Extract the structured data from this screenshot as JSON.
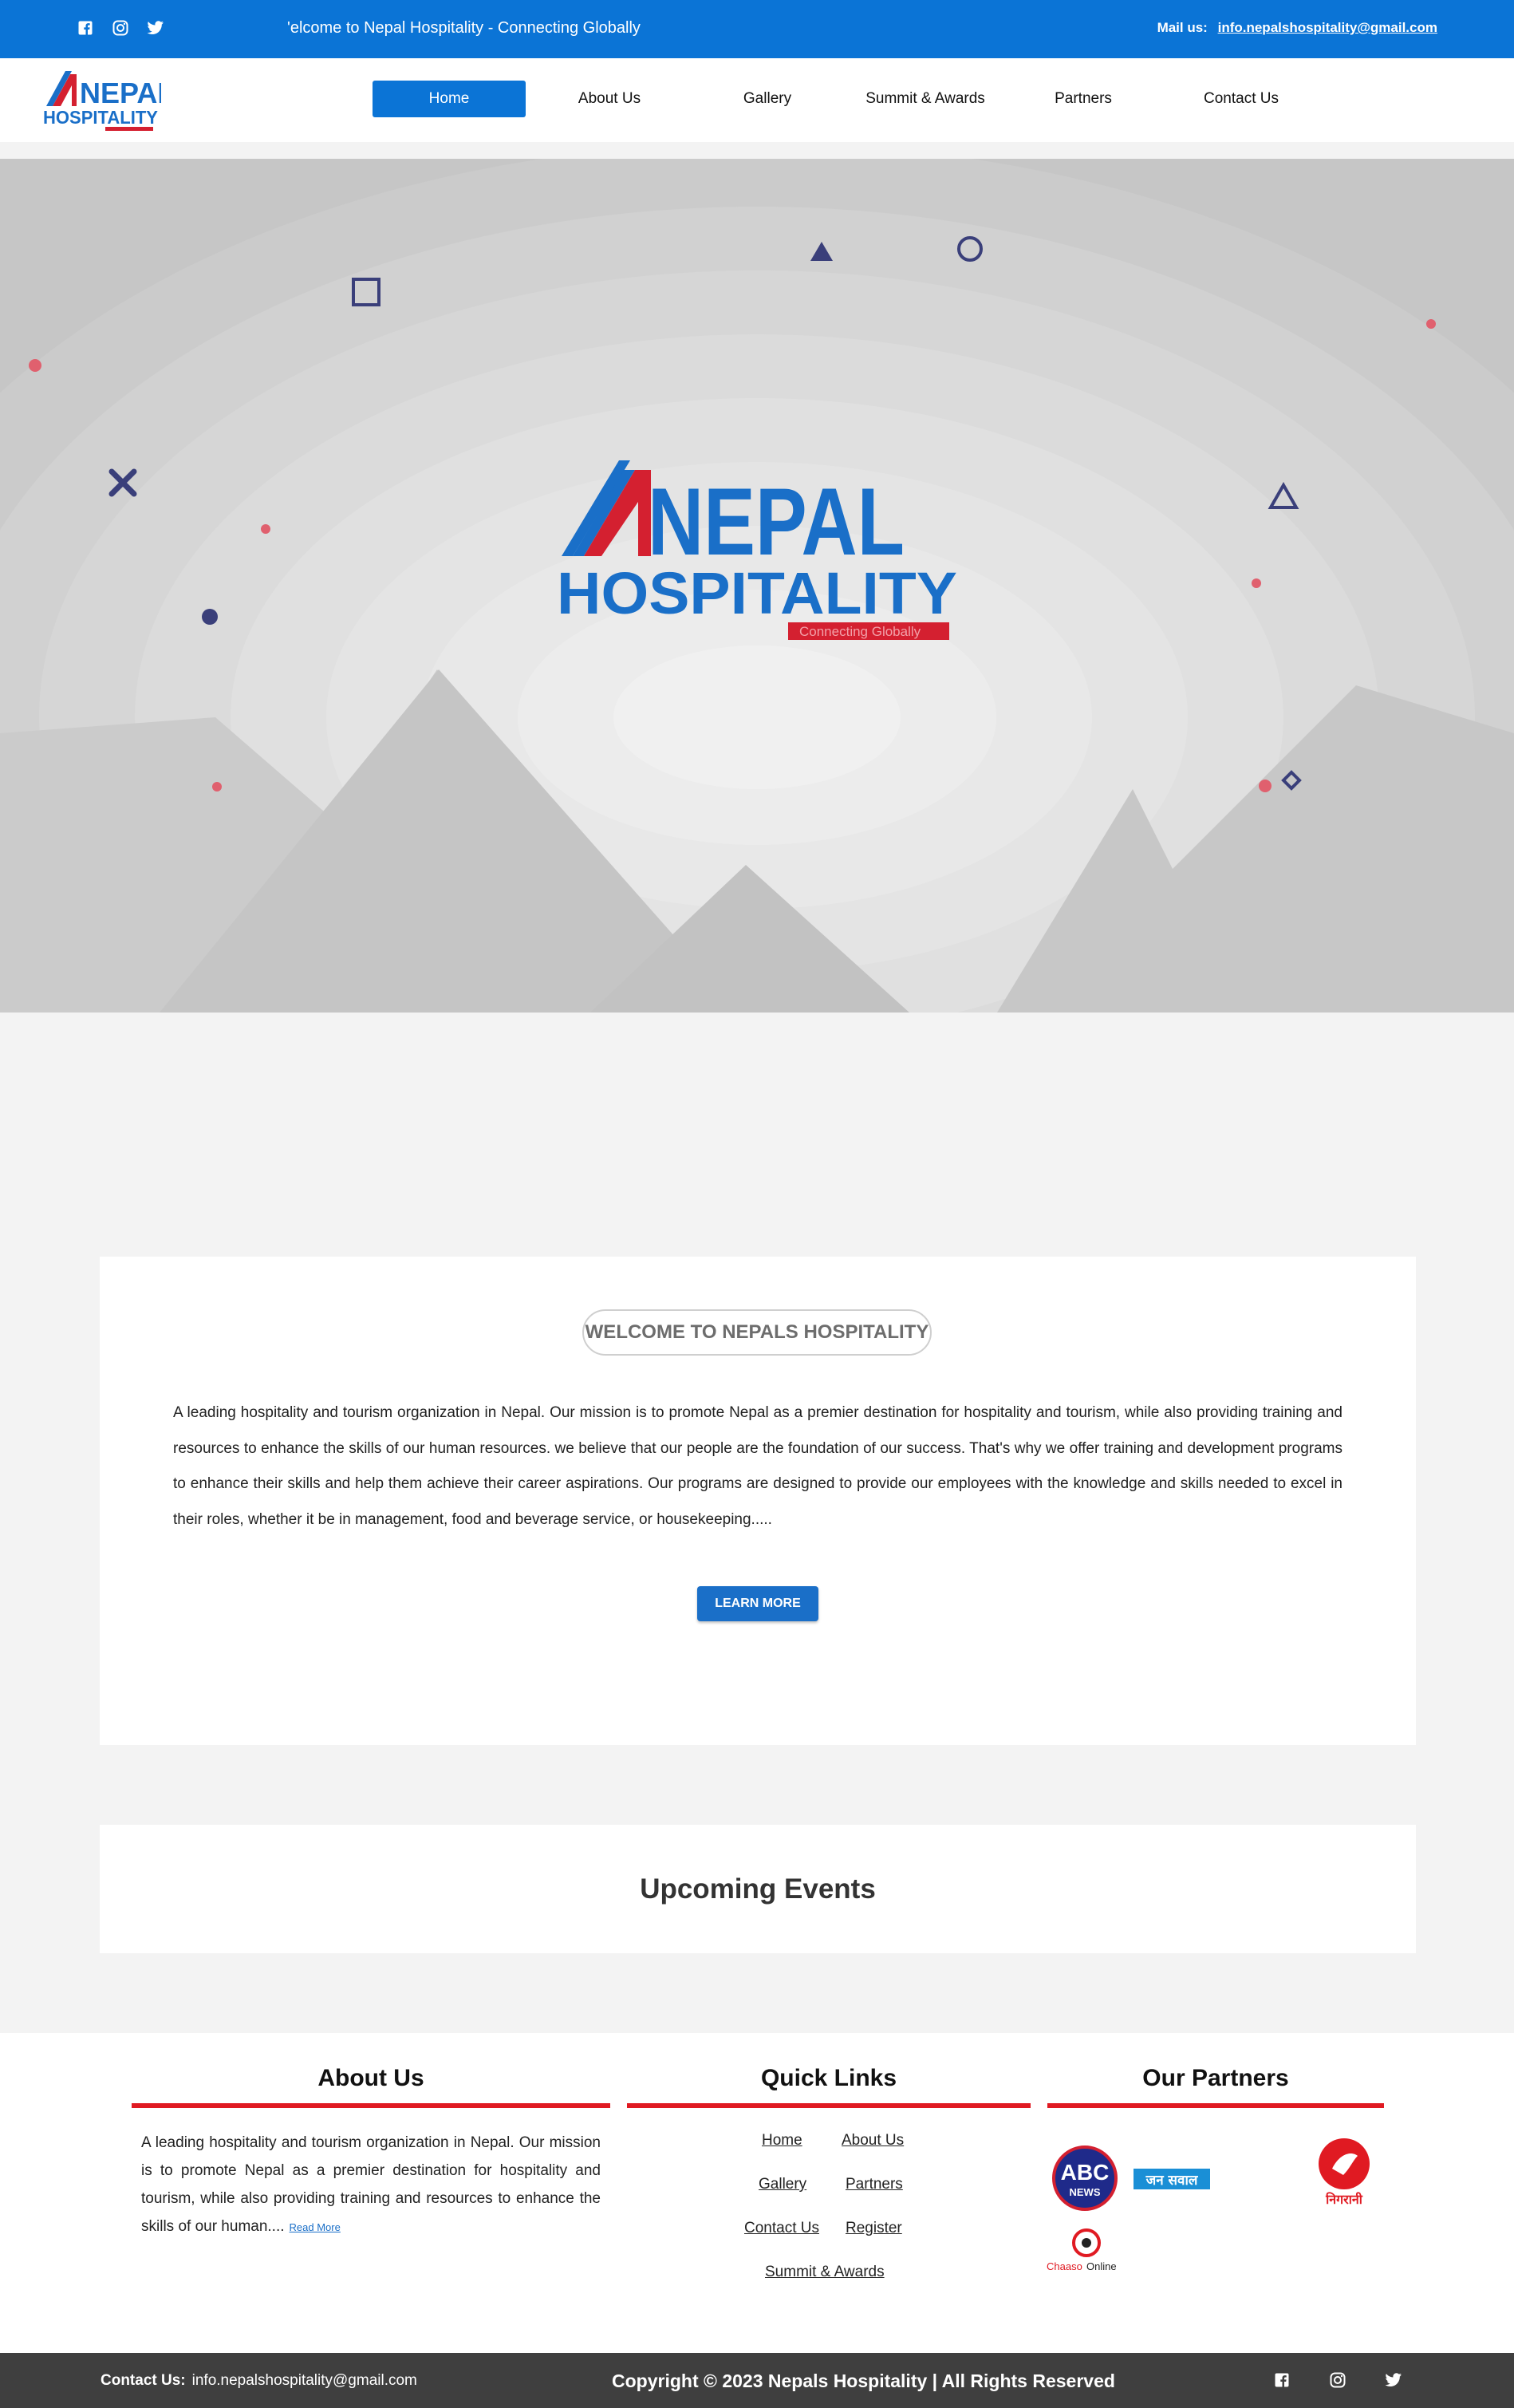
{
  "topbar": {
    "social_icons": [
      "facebook-icon",
      "instagram-icon",
      "twitter-icon"
    ],
    "welcome": "'elcome to Nepal Hospitality - Connecting Globally",
    "mail_label": "Mail us:",
    "mail_address": "info.nepalshospitality@gmail.com"
  },
  "logo": {
    "line1": "NEPAL",
    "line2": "HOSPITALITY",
    "tagline": "Connecting Globally"
  },
  "nav": {
    "items": [
      {
        "label": "Home",
        "active": true
      },
      {
        "label": "About Us"
      },
      {
        "label": "Gallery"
      },
      {
        "label": "Summit & Awards"
      },
      {
        "label": "Partners"
      },
      {
        "label": "Contact Us"
      }
    ]
  },
  "welcome": {
    "title": "WELCOME TO NEPALS HOSPITALITY",
    "body": "A leading hospitality and tourism organization in Nepal. Our mission is to promote Nepal as a premier destination for hospitality and tourism, while also providing training and resources to enhance the skills of our human resources. we believe that our people are the foundation of our success. That's why we offer training and development programs to enhance their skills and help them achieve their career aspirations. Our programs are designed to provide our employees with the knowledge and skills needed to excel in their roles, whether it be in management, food and beverage service, or housekeeping.....",
    "button": "LEARN MORE"
  },
  "events": {
    "title": "Upcoming Events"
  },
  "footer": {
    "about_title": "About Us",
    "about_text": "A leading hospitality and tourism organization in Nepal. Our mission is to promote Nepal as a premier destination for hospitality and tourism, while also providing training and resources to enhance the skills of our human....",
    "read_more": "Read More",
    "links_title": "Quick Links",
    "links": [
      "Home",
      "About Us",
      "Gallery",
      "Partners",
      "Contact Us",
      "Register",
      "Summit & Awards"
    ],
    "partners_title": "Our Partners",
    "partners": {
      "abc_line1": "ABC",
      "abc_line2": "NEWS",
      "jansawal": "जन सवाल",
      "nigrani": "निगरानी",
      "chaaso_a": "Chaaso",
      "chaaso_b": "Online"
    }
  },
  "bottombar": {
    "contact_label": "Contact Us:",
    "contact_email": "info.nepalshospitality@gmail.com",
    "copyright": "Copyright © 2023 Nepals Hospitality | All Rights Reserved",
    "social_icons": [
      "facebook-icon",
      "instagram-icon",
      "twitter-icon"
    ]
  },
  "colors": {
    "primary": "#0b74d6",
    "accent_red": "#e01a22",
    "logo_blue": "#1a6fc8",
    "logo_red": "#d42030",
    "footer_dark": "#3f3f3f"
  }
}
